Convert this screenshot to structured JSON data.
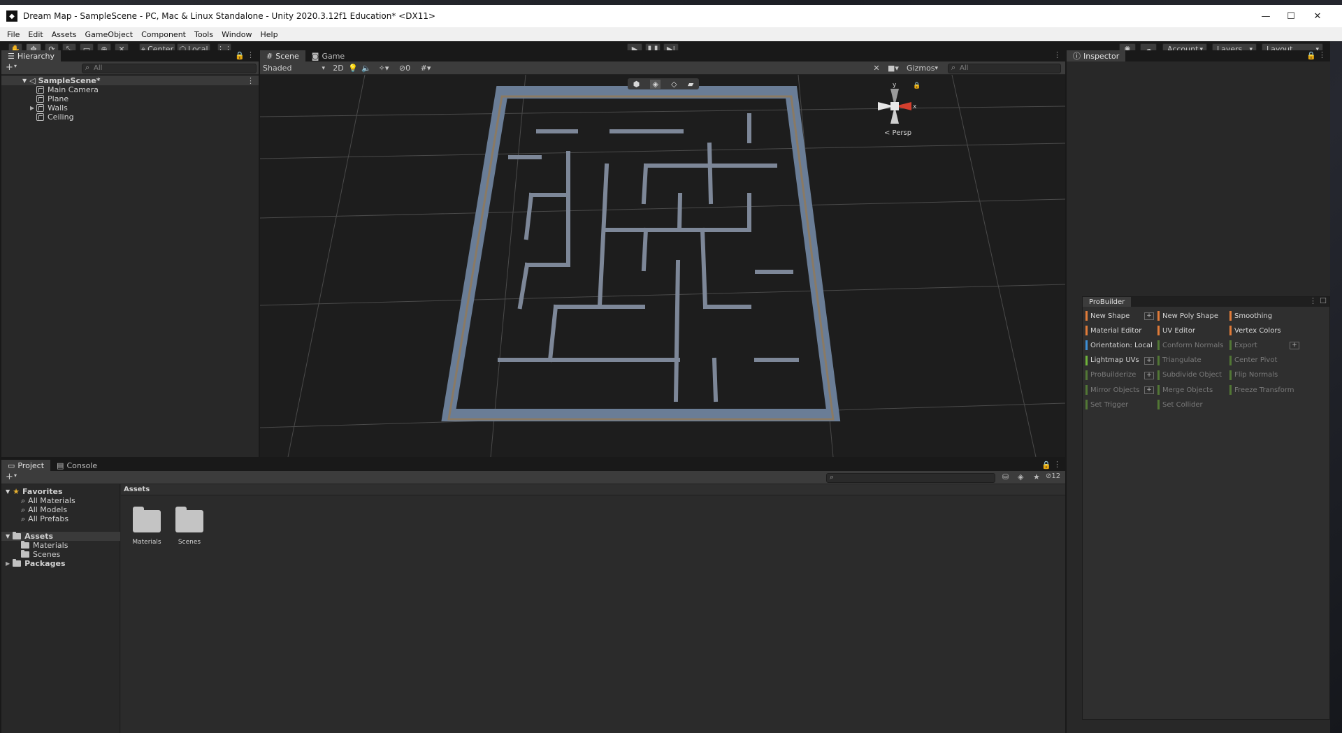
{
  "window": {
    "title": "Dream Map - SampleScene - PC, Mac & Linux Standalone - Unity 2020.3.12f1 Education* <DX11>",
    "controls": {
      "minimize": "—",
      "maximize": "☐",
      "close": "✕"
    }
  },
  "menu": [
    "File",
    "Edit",
    "Assets",
    "GameObject",
    "Component",
    "Tools",
    "Window",
    "Help"
  ],
  "toolbar": {
    "pivot": "Center",
    "space": "Local",
    "account": "Account",
    "layers": "Layers",
    "layout": "Layout"
  },
  "hierarchy": {
    "tab": "Hierarchy",
    "add": "+",
    "search_placeholder": "All",
    "scene": "SampleScene*",
    "items": [
      "Main Camera",
      "Plane",
      "Walls",
      "Ceiling"
    ]
  },
  "scene_view": {
    "tabs": [
      "Scene",
      "Game"
    ],
    "shading": "Shaded",
    "mode_2d": "2D",
    "hidden_count": "0",
    "gizmos": "Gizmos",
    "search_placeholder": "All",
    "orientation": {
      "y": "y",
      "x": "x",
      "view": "< Persp"
    }
  },
  "inspector": {
    "tab": "Inspector"
  },
  "probuilder": {
    "title": "ProBuilder",
    "col1": [
      {
        "label": "New Shape",
        "color": "#e07b39",
        "enabled": true,
        "plus": true
      },
      {
        "label": "Material Editor",
        "color": "#e07b39",
        "enabled": true,
        "plus": false
      },
      {
        "label": "Orientation: Local",
        "color": "#3d8fd6",
        "enabled": true,
        "plus": false
      },
      {
        "label": "Lightmap UVs",
        "color": "#6fb33a",
        "enabled": true,
        "plus": true
      },
      {
        "label": "ProBuilderize",
        "color": "#6fb33a",
        "enabled": false,
        "plus": true
      },
      {
        "label": "Mirror Objects",
        "color": "#6fb33a",
        "enabled": false,
        "plus": true
      },
      {
        "label": "Set Trigger",
        "color": "#6fb33a",
        "enabled": false,
        "plus": false
      }
    ],
    "col2": [
      {
        "label": "New Poly Shape",
        "color": "#e07b39",
        "enabled": true
      },
      {
        "label": "UV Editor",
        "color": "#e07b39",
        "enabled": true
      },
      {
        "label": "Conform Normals",
        "color": "#6fb33a",
        "enabled": false
      },
      {
        "label": "Triangulate",
        "color": "#6fb33a",
        "enabled": false
      },
      {
        "label": "Subdivide Object",
        "color": "#6fb33a",
        "enabled": false
      },
      {
        "label": "Merge Objects",
        "color": "#6fb33a",
        "enabled": false
      },
      {
        "label": "Set Collider",
        "color": "#6fb33a",
        "enabled": false
      }
    ],
    "col3": [
      {
        "label": "Smoothing",
        "color": "#e07b39",
        "enabled": true,
        "plus": false
      },
      {
        "label": "Vertex Colors",
        "color": "#e07b39",
        "enabled": true,
        "plus": false
      },
      {
        "label": "Export",
        "color": "#6fb33a",
        "enabled": false,
        "plus": true
      },
      {
        "label": "Center Pivot",
        "color": "#6fb33a",
        "enabled": false,
        "plus": false
      },
      {
        "label": "Flip Normals",
        "color": "#6fb33a",
        "enabled": false,
        "plus": false
      },
      {
        "label": "Freeze Transform",
        "color": "#6fb33a",
        "enabled": false,
        "plus": false
      }
    ]
  },
  "project": {
    "tabs": [
      "Project",
      "Console"
    ],
    "add": "+",
    "hidden_count": "12",
    "favorites": {
      "label": "Favorites",
      "items": [
        "All Materials",
        "All Models",
        "All Prefabs"
      ]
    },
    "tree": {
      "assets": "Assets",
      "children": [
        "Materials",
        "Scenes"
      ],
      "packages": "Packages"
    },
    "breadcrumb": "Assets",
    "folders": [
      "Materials",
      "Scenes"
    ]
  }
}
